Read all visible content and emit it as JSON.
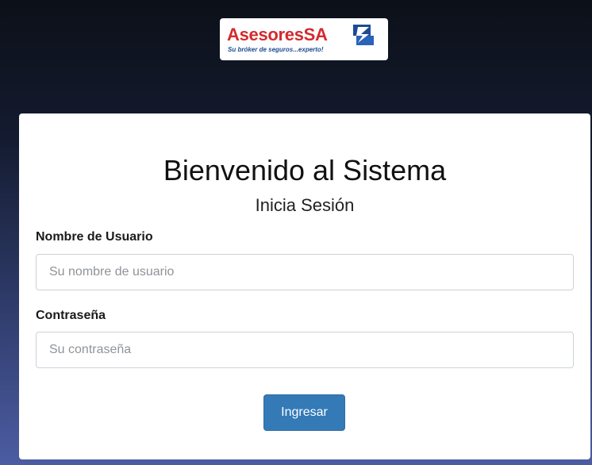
{
  "logo": {
    "brand": "AsesoresSA",
    "tagline": "Su bróker de seguros...experto!",
    "icon": "shield-arrow-logo-mark",
    "colors": {
      "brand_red": "#d32a2e",
      "brand_blue": "#1e4b93"
    }
  },
  "login": {
    "title": "Bienvenido al Sistema",
    "subtitle": "Inicia Sesión",
    "username": {
      "label": "Nombre de Usuario",
      "placeholder": "Su nombre de usuario",
      "value": ""
    },
    "password": {
      "label": "Contraseña",
      "placeholder": "Su contraseña",
      "value": ""
    },
    "submit_label": "Ingresar"
  },
  "colors": {
    "primary_button": "#337ab7",
    "card_background": "#ffffff",
    "page_background_top": "#0c1018",
    "page_background_bottom": "#4c5ca3"
  }
}
